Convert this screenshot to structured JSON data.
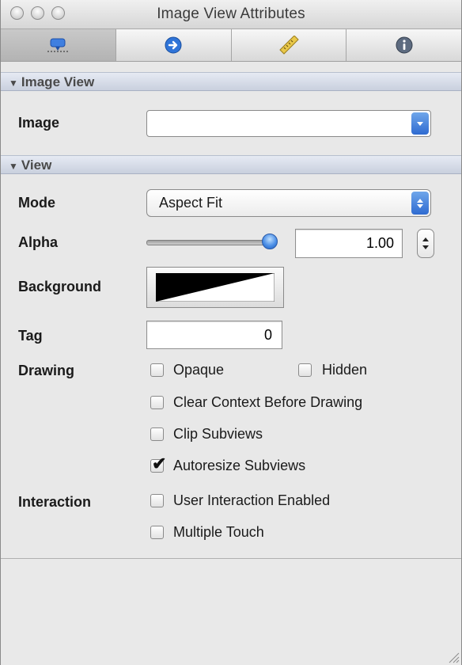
{
  "window": {
    "title": "Image View Attributes"
  },
  "tabs": [
    {
      "icon": "identity-icon",
      "selected": true
    },
    {
      "icon": "connections-icon",
      "selected": false
    },
    {
      "icon": "size-ruler-icon",
      "selected": false
    },
    {
      "icon": "info-icon",
      "selected": false
    }
  ],
  "image_view_section": {
    "header": "Image View",
    "image_label": "Image",
    "image_value": ""
  },
  "view_section": {
    "header": "View",
    "mode_label": "Mode",
    "mode_value": "Aspect Fit",
    "alpha_label": "Alpha",
    "alpha_value": "1.00",
    "alpha_fraction": 1.0,
    "background_label": "Background",
    "tag_label": "Tag",
    "tag_value": "0",
    "drawing_label": "Drawing",
    "drawing_options": [
      {
        "label": "Opaque",
        "checked": false
      },
      {
        "label": "Hidden",
        "checked": false
      },
      {
        "label": "Clear Context Before Drawing",
        "checked": false
      },
      {
        "label": "Clip Subviews",
        "checked": false
      },
      {
        "label": "Autoresize Subviews",
        "checked": true
      }
    ],
    "interaction_label": "Interaction",
    "interaction_options": [
      {
        "label": "User Interaction Enabled",
        "checked": false
      },
      {
        "label": "Multiple Touch",
        "checked": false
      }
    ]
  },
  "colors": {
    "header_bg": "#cdd4e2",
    "accent_blue": "#3f7fe0"
  }
}
